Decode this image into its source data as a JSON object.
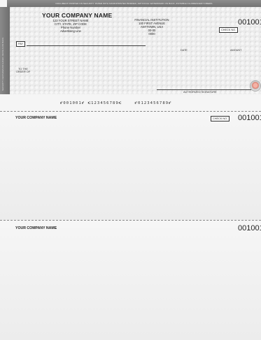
{
  "banner": {
    "text": "DOCUMENT PRINTED ON SECURITY PAPER WITH MICROPRINTED BORDER, ARTIFICIAL WATERMARK ON BACK, INVISIBLE FLUORESCENT FIBERS"
  },
  "left_stub": {
    "text": "SECURITY FEATURES INCLUDED. DETAILS ON BACK."
  },
  "check": {
    "company": {
      "name": "YOUR COMPANY NAME",
      "street": "123 YOUR STREET NAME",
      "city": "CITY, STATE, ZIP CODE",
      "phone": "Phone Number",
      "ad": "Advertising Line"
    },
    "bank": {
      "name": "FINANCIAL INSTITUTION",
      "street": "100 FIRST AVENUE",
      "city": "ANYTOWN, USA",
      "routing": "00-00",
      "routing2": "0000"
    },
    "check_number": "001001",
    "check_no_label": "CHECK NO.",
    "pay_label": "PAY",
    "date_label": "DATE",
    "amount_label": "AMOUNT",
    "to_order_label": "TO THE ORDER OF",
    "signature_label": "AUTHORIZED SIGNATURE",
    "micr": {
      "check": "⑈001001⑈",
      "routing": "⑆123456789⑆",
      "account": "⑈0123456789⑈"
    }
  },
  "stub1": {
    "company": "YOUR COMPANY NAME",
    "check_no_label": "CHECK NO.",
    "check_number": "001001"
  },
  "stub2": {
    "company": "YOUR COMPANY NAME",
    "check_number": "001001"
  },
  "colors": {
    "banner": "#7e7e7e",
    "check_bg": "#ebebeb",
    "logo_accent": "#e07c6a"
  }
}
